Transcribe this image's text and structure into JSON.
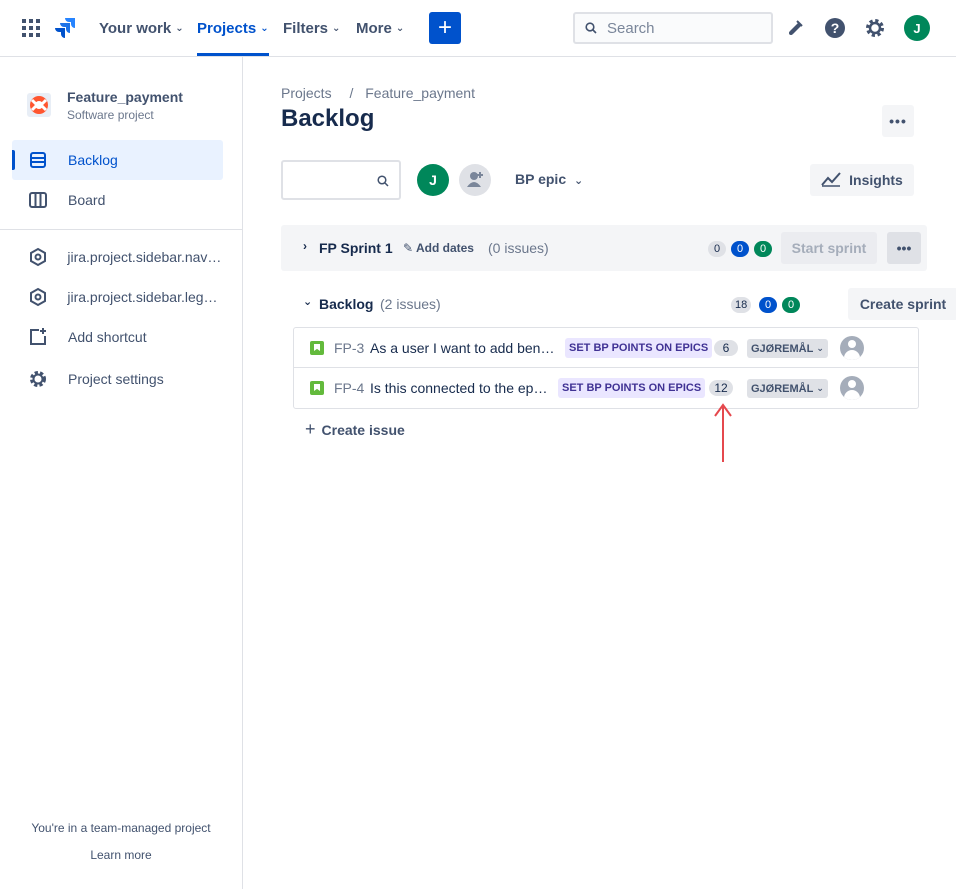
{
  "topbar": {
    "nav": [
      {
        "label": "Your work"
      },
      {
        "label": "Projects"
      },
      {
        "label": "Filters"
      },
      {
        "label": "More"
      }
    ],
    "search_placeholder": "Search",
    "avatar_initial": "J"
  },
  "sidebar": {
    "project_name": "Feature_payment",
    "project_type": "Software project",
    "items": [
      {
        "label": "Backlog"
      },
      {
        "label": "Board"
      },
      {
        "label": "jira.project.sidebar.navigation.item"
      },
      {
        "label": "jira.project.sidebar.legacy.item"
      },
      {
        "label": "Add shortcut"
      },
      {
        "label": "Project settings"
      }
    ],
    "footer_text": "You're in a team-managed project",
    "footer_link": "Learn more"
  },
  "main": {
    "breadcrumbs": [
      "Projects",
      "/",
      "Feature_payment"
    ],
    "title": "Backlog",
    "avatar_initial": "J",
    "epic_filter": "BP epic",
    "insights_label": "Insights",
    "sprint": {
      "name": "FP Sprint 1",
      "add_dates": "Add dates",
      "issue_count": "(0 issues)",
      "counts": [
        "0",
        "0",
        "0"
      ],
      "start_label": "Start sprint"
    },
    "backlog": {
      "name": "Backlog",
      "issue_count": "(2 issues)",
      "counts": [
        "18",
        "0",
        "0"
      ],
      "create_sprint_label": "Create sprint"
    },
    "issues": [
      {
        "key": "FP-3",
        "summary": "As a user I want to add beneficiaries",
        "epic": "SET BP POINTS ON EPICS",
        "estimate": "6",
        "status": "GJØREMÅL"
      },
      {
        "key": "FP-4",
        "summary": "Is this connected to the epic?",
        "epic": "SET BP POINTS ON EPICS",
        "estimate": "12",
        "status": "GJØREMÅL"
      }
    ],
    "create_issue_label": "Create issue"
  },
  "colors": {
    "accent": "#0052cc",
    "success": "#00875a",
    "epic_bg": "#eae6ff",
    "epic_text": "#403294",
    "annotation_arrow": "#e5484d"
  }
}
